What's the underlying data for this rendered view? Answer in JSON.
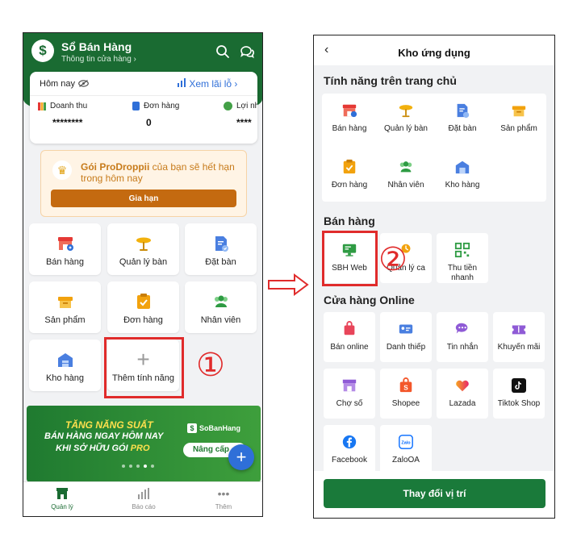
{
  "left_screen": {
    "header": {
      "title": "Sổ Bán Hàng",
      "subtitle": "Thông tin cửa hàng ›",
      "logo_glyph": "$"
    },
    "stats": {
      "today_label": "Hôm nay",
      "profit_link": "Xem lãi lỗ  ›",
      "revenue_label": "Doanh thu",
      "revenue_value": "********",
      "orders_label": "Đơn hàng",
      "orders_value": "0",
      "profit_label": "Lợi nhuận",
      "profit_value": "****"
    },
    "promo": {
      "plan_name": "Gói ProDroppii",
      "message": " của bạn sẽ hết hạn trong hôm nay",
      "renew_button": "Gia hạn"
    },
    "tiles": [
      {
        "label": "Bán hàng",
        "icon": "store-icon"
      },
      {
        "label": "Quản lý bàn",
        "icon": "table-icon"
      },
      {
        "label": "Đặt bàn",
        "icon": "booking-icon"
      },
      {
        "label": "Sản phẩm",
        "icon": "product-box-icon"
      },
      {
        "label": "Đơn hàng",
        "icon": "order-clipboard-icon"
      },
      {
        "label": "Nhân viên",
        "icon": "staff-icon"
      },
      {
        "label": "Kho hàng",
        "icon": "warehouse-icon"
      },
      {
        "label": "Thêm tính năng",
        "icon": "plus-icon"
      }
    ],
    "step_marker": "①",
    "banner": {
      "line1": "TĂNG NĂNG SUẤT",
      "line2": "BÁN HÀNG NGAY HÔM NAY",
      "line3_a": "KHI SỞ HỮU GÓI ",
      "line3_b": "PRO",
      "logo_text": "SoBanHang",
      "cta": "Nâng cấp"
    },
    "bottom_nav": [
      {
        "label": "Quản lý",
        "active": true
      },
      {
        "label": "Báo cáo",
        "active": false
      },
      {
        "label": "Thêm",
        "active": false
      }
    ]
  },
  "right_screen": {
    "header": {
      "title": "Kho ứng dụng",
      "back_glyph": "‹"
    },
    "section_home": {
      "title": "Tính năng trên trang chủ",
      "apps": [
        "Bán hàng",
        "Quản lý bàn",
        "Đặt bàn",
        "Sản phẩm",
        "Đơn hàng",
        "Nhân viên",
        "Kho hàng"
      ]
    },
    "section_sales": {
      "title": "Bán hàng",
      "apps": [
        "SBH Web",
        "Quản lý ca",
        "Thu tiền\nnhanh"
      ]
    },
    "section_online": {
      "title": "Cửa hàng Online",
      "apps": [
        "Bán online",
        "Danh thiếp",
        "Tin nhắn",
        "Khuyến mãi",
        "Chợ số",
        "Shopee",
        "Lazada",
        "Tiktok Shop",
        "Facebook",
        "ZaloOA"
      ]
    },
    "step_marker": "②",
    "footer_button": "Thay đổi vị trí"
  },
  "colors": {
    "brand_green": "#1a6b32",
    "highlight_red": "#e02b2b",
    "link_blue": "#2f6fd8",
    "promo_orange": "#c46a10"
  }
}
